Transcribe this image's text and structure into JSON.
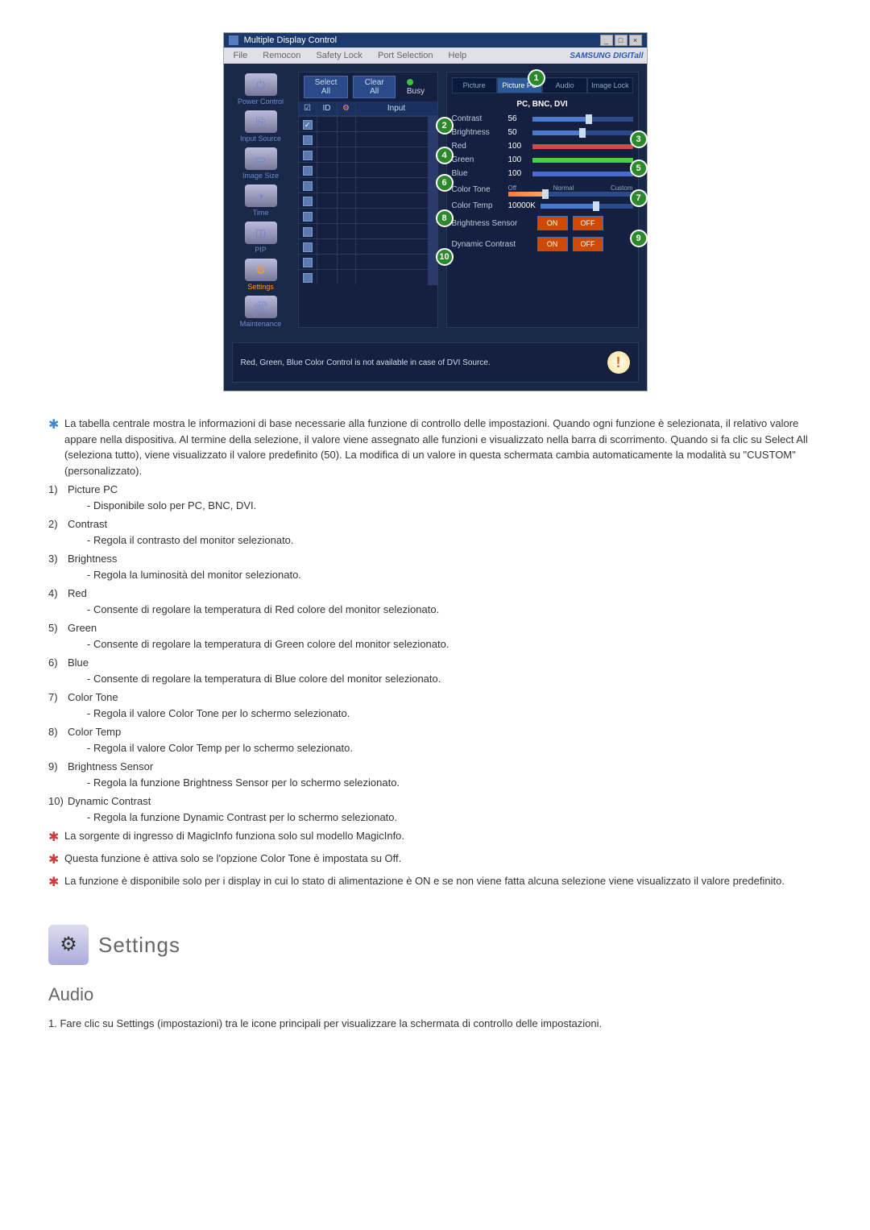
{
  "screenshot": {
    "title": "Multiple Display Control",
    "menus": [
      "File",
      "Remocon",
      "Safety Lock",
      "Port Selection",
      "Help"
    ],
    "brand": "SAMSUNG DIGITall",
    "sidebar": [
      {
        "label": "Power Control"
      },
      {
        "label": "Input Source"
      },
      {
        "label": "Image Size"
      },
      {
        "label": "Time"
      },
      {
        "label": "PIP"
      },
      {
        "label": "Settings",
        "active": true
      },
      {
        "label": "Maintenance"
      }
    ],
    "buttons": {
      "select_all": "Select All",
      "clear_all": "Clear All",
      "busy": "Busy"
    },
    "grid": {
      "cb": "☑",
      "id_head": "ID",
      "input_head": "Input",
      "rows": 11
    },
    "tabs": [
      "Picture",
      "Picture PC",
      "Audio",
      "Image Lock"
    ],
    "subtitle": "PC, BNC, DVI",
    "controls": [
      {
        "label": "Contrast",
        "val": "56",
        "pct": 56
      },
      {
        "label": "Brightness",
        "val": "50",
        "pct": 50
      },
      {
        "label": "Red",
        "val": "100",
        "pct": 100,
        "cls": "red"
      },
      {
        "label": "Green",
        "val": "100",
        "pct": 100,
        "cls": "green"
      },
      {
        "label": "Blue",
        "val": "100",
        "pct": 100,
        "cls": "blue"
      }
    ],
    "color_tone": {
      "label": "Color Tone",
      "opts": [
        "Off",
        "Normal",
        "Custom"
      ],
      "val": 18
    },
    "color_temp": {
      "label": "Color Temp",
      "val": "10000K",
      "pct": 60
    },
    "brightness_sensor": {
      "label": "Brightness Sensor",
      "on": "ON",
      "off": "OFF"
    },
    "dynamic_contrast": {
      "label": "Dynamic Contrast",
      "on": "ON",
      "off": "OFF"
    },
    "footer": "Red, Green, Blue Color Control is not available in case of DVI Source.",
    "callouts": {
      "c1": "1",
      "c2": "2",
      "c3": "3",
      "c4": "4",
      "c5": "5",
      "c6": "6",
      "c7": "7",
      "c8": "8",
      "c9": "9",
      "c10": "10"
    }
  },
  "doc": {
    "intro": "La tabella centrale mostra le informazioni di base necessarie alla funzione di controllo delle impostazioni. Quando ogni funzione è selezionata, il relativo valore appare nella dispositiva. Al termine della selezione, il valore viene assegnato alle funzioni e visualizzato nella barra di scorrimento. Quando si fa clic su Select All (seleziona tutto), viene visualizzato il valore predefinito (50). La modifica di un valore in questa schermata cambia automaticamente la modalità su \"CUSTOM\" (personalizzato).",
    "items": [
      {
        "n": "1)",
        "t": "Picture PC",
        "s": "- Disponibile solo per PC, BNC, DVI."
      },
      {
        "n": "2)",
        "t": "Contrast",
        "s": "- Regola il contrasto del monitor selezionato."
      },
      {
        "n": "3)",
        "t": "Brightness",
        "s": "- Regola la luminosità del monitor selezionato."
      },
      {
        "n": "4)",
        "t": "Red",
        "s": "- Consente di regolare la temperatura di Red colore del monitor selezionato."
      },
      {
        "n": "5)",
        "t": "Green",
        "s": "- Consente di regolare la temperatura di Green colore del monitor selezionato."
      },
      {
        "n": "6)",
        "t": "Blue",
        "s": "- Consente di regolare la temperatura di Blue colore del monitor selezionato."
      },
      {
        "n": "7)",
        "t": "Color Tone",
        "s": "- Regola il valore Color Tone per lo schermo selezionato."
      },
      {
        "n": "8)",
        "t": "Color Temp",
        "s": "- Regola il valore Color Temp per lo schermo selezionato."
      },
      {
        "n": "9)",
        "t": "Brightness Sensor",
        "s": "- Regola la funzione Brightness Sensor per lo schermo selezionato."
      },
      {
        "n": "10)",
        "t": "Dynamic Contrast",
        "s": "- Regola la funzione Dynamic Contrast per lo schermo selezionato."
      }
    ],
    "notes": [
      "La sorgente di ingresso di MagicInfo funziona solo sul modello MagicInfo.",
      "Questa funzione è attiva solo se l'opzione Color Tone è impostata su Off.",
      "La funzione è disponibile solo per i display in cui lo stato di alimentazione è ON e se non viene fatta alcuna selezione viene visualizzato il valore predefinito."
    ],
    "section_title": "Settings",
    "subsection": "Audio",
    "audio_step": "1. Fare clic su Settings (impostazioni) tra le icone principali per visualizzare la schermata di controllo delle impostazioni."
  }
}
